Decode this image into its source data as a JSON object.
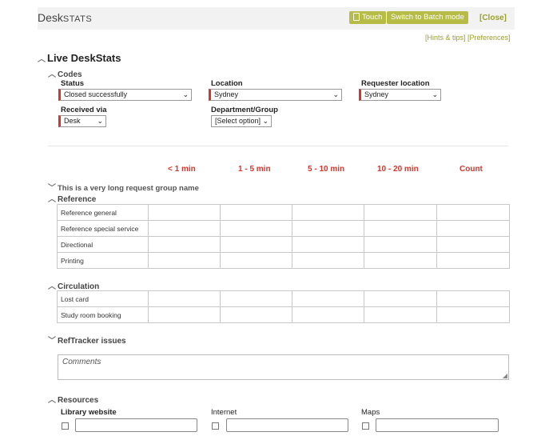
{
  "header": {
    "logo_main": "Desk",
    "logo_caps": "STATS",
    "touch_label": "Touch",
    "batch_label": "Switch to Batch mode",
    "close_label": "[Close]",
    "hints_label": "[Hints & tips]",
    "preferences_label": "[Preferences]"
  },
  "live_title": "Live DeskStats",
  "codes": {
    "title": "Codes",
    "status": {
      "label": "Status",
      "value": "Closed successfully"
    },
    "location": {
      "label": "Location",
      "value": "Sydney"
    },
    "requester_location": {
      "label": "Requester location",
      "value": "Sydney"
    },
    "received_via": {
      "label": "Received via",
      "value": "Desk"
    },
    "department": {
      "label": "Department/Group",
      "value": "[Select option]"
    }
  },
  "columns": [
    "< 1 min",
    "1 - 5 min",
    "5 - 10 min",
    "10 - 20 min",
    "Count"
  ],
  "long_group": "This is a very long request group name",
  "reference": {
    "title": "Reference",
    "rows": [
      "Reference general",
      "Reference special service",
      "Directional",
      "Printing"
    ]
  },
  "circulation": {
    "title": "Circulation",
    "rows": [
      "Lost card",
      "Study room booking"
    ]
  },
  "reftracker": {
    "title": "RefTracker issues",
    "placeholder": "Comments"
  },
  "resources": {
    "title": "Resources",
    "items": [
      "Library website",
      "Internet",
      "Maps"
    ]
  }
}
